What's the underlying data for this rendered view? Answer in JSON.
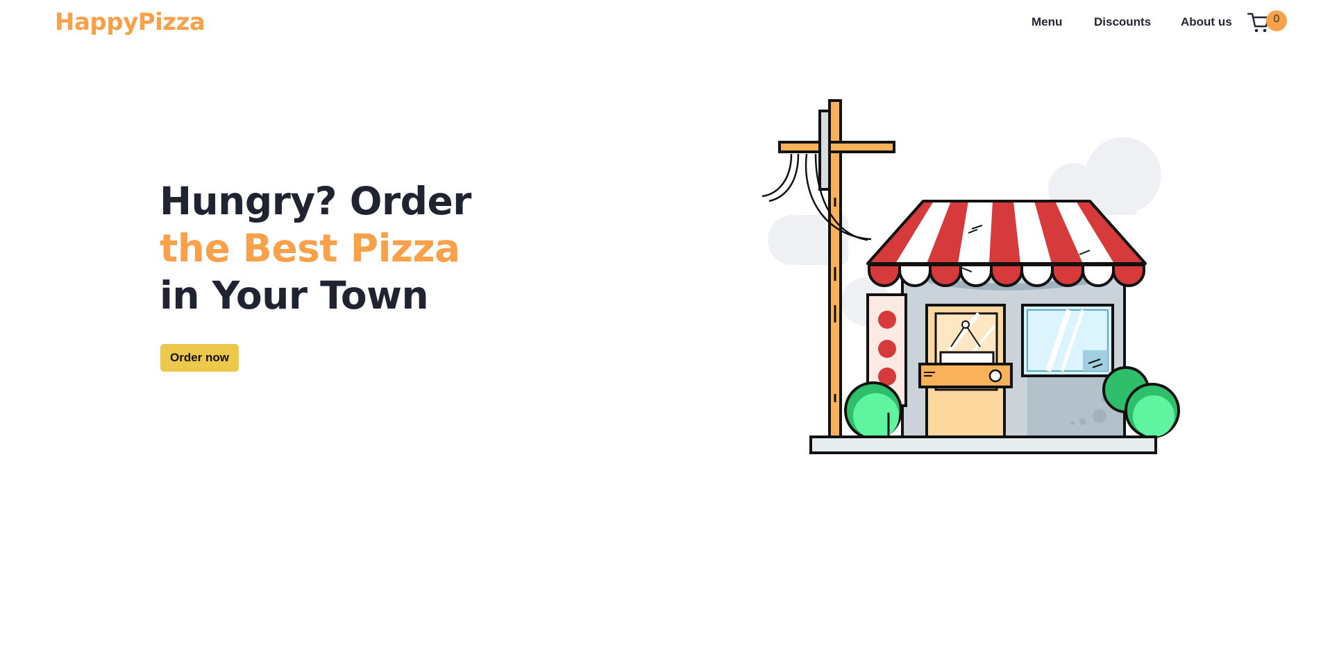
{
  "header": {
    "logo": "HappyPizza",
    "nav": [
      {
        "label": "Menu"
      },
      {
        "label": "Discounts"
      },
      {
        "label": "About us"
      }
    ],
    "cart": {
      "icon": "cart-icon",
      "count": "0"
    }
  },
  "hero": {
    "title_line1": "Hungry? Order",
    "title_line2": "the Best Pizza",
    "title_line3": "in Your Town",
    "cta_label": "Order now"
  },
  "colors": {
    "accent": "#f9a14a",
    "cta": "#ecc94b",
    "text": "#1f2430",
    "awning_red": "#d63a3a",
    "bush_green": "#5ff5a0"
  }
}
